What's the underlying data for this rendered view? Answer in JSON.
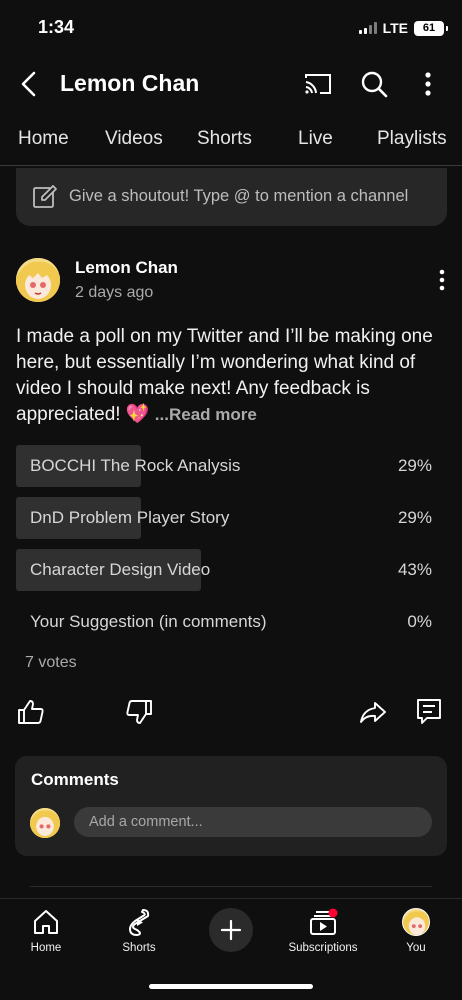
{
  "status_bar": {
    "time": "1:34",
    "network": "LTE",
    "battery": "61"
  },
  "header": {
    "title": "Lemon Chan",
    "icons": {
      "back": "back-arrow-icon",
      "cast": "cast-icon",
      "search": "search-icon",
      "more": "more-vert-icon"
    }
  },
  "tabs": [
    {
      "label": "Home"
    },
    {
      "label": "Videos"
    },
    {
      "label": "Shorts"
    },
    {
      "label": "Live"
    },
    {
      "label": "Playlists"
    }
  ],
  "shoutout": {
    "placeholder": "Give a shoutout! Type @ to mention a channel"
  },
  "post": {
    "author": "Lemon Chan",
    "time": "2 days ago",
    "text": "I made a poll on my Twitter and I’ll be making one here, but essentially I’m wondering what kind of video I should make next! Any feedback is appreciated! 💖 ",
    "read_more": "...Read more",
    "poll": [
      {
        "label": "BOCCHI The Rock Analysis",
        "percent": "29%",
        "value": 29
      },
      {
        "label": "DnD Problem Player Story",
        "percent": "29%",
        "value": 29
      },
      {
        "label": "Character Design Video",
        "percent": "43%",
        "value": 43
      },
      {
        "label": "Your Suggestion (in comments)",
        "percent": "0%",
        "value": 0
      }
    ],
    "votes": "7 votes"
  },
  "comments": {
    "title": "Comments",
    "placeholder": "Add a comment..."
  },
  "bottom_nav": {
    "home": "Home",
    "shorts": "Shorts",
    "subscriptions": "Subscriptions",
    "you": "You"
  },
  "colors": {
    "background": "#0f0f0f",
    "card": "#212121",
    "accent_dot": "#ff0033"
  }
}
